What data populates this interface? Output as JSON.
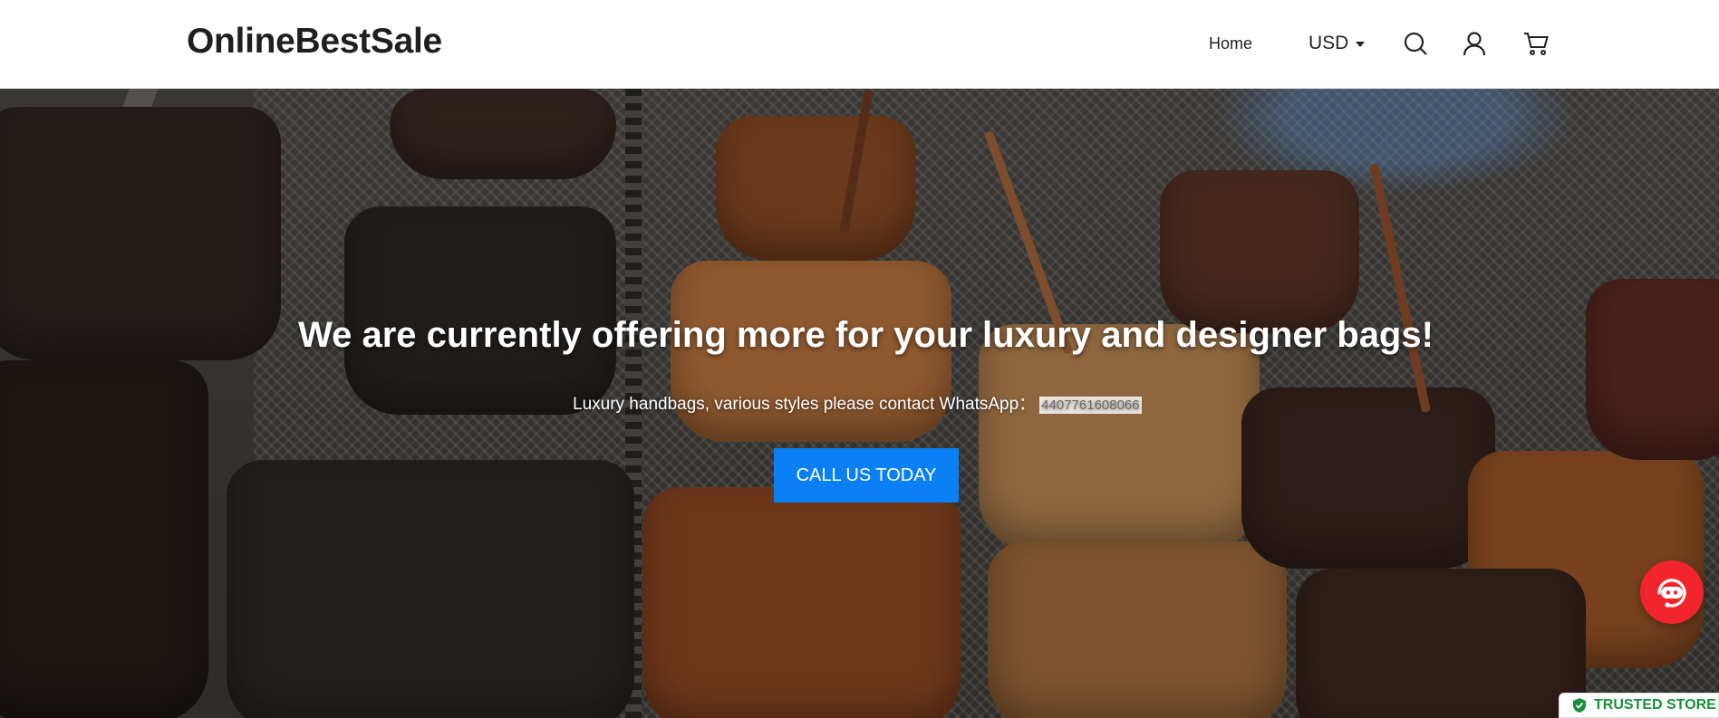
{
  "header": {
    "logo": "OnlineBestSale",
    "nav_home": "Home",
    "currency": "USD",
    "icons": [
      "search-icon",
      "account-icon",
      "cart-icon"
    ]
  },
  "hero": {
    "title": "We are currently offering more for your luxury and designer bags!",
    "subtitle": "Luxury handbags, various styles please contact WhatsApp：",
    "phone": "4407761608066",
    "cta_label": "CALL US TODAY",
    "cta_color": "#0b80f5"
  },
  "widgets": {
    "chat_icon": "chat-support-icon",
    "chat_color": "#f1252b",
    "trusted_label": "TRUSTED STORE",
    "trusted_color": "#1a8f3a"
  }
}
